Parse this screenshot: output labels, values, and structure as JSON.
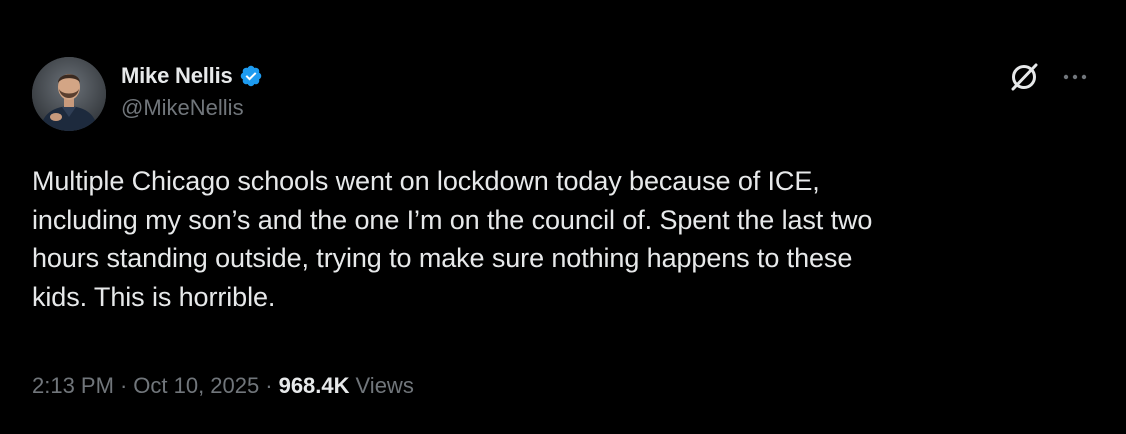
{
  "author": {
    "display_name": "Mike Nellis",
    "handle": "@MikeNellis",
    "verified": true,
    "verified_color": "#1d9bf0"
  },
  "actions": {
    "grok_icon": "slashed-circle-icon",
    "more_icon": "more-dots-icon"
  },
  "tweet": {
    "text": "Multiple Chicago schools went on lockdown today because of ICE,\nincluding my son’s and the one I’m on the council of. Spent the last two\nhours standing outside, trying to make sure nothing happens to these\nkids. This is horrible."
  },
  "meta": {
    "time": "2:13 PM",
    "separator": "·",
    "date": "Oct 10, 2025",
    "views_count": "968.4K",
    "views_label": "Views"
  },
  "colors": {
    "background": "#000000",
    "primary_text": "#e7e9ea",
    "secondary_text": "#71767b"
  }
}
